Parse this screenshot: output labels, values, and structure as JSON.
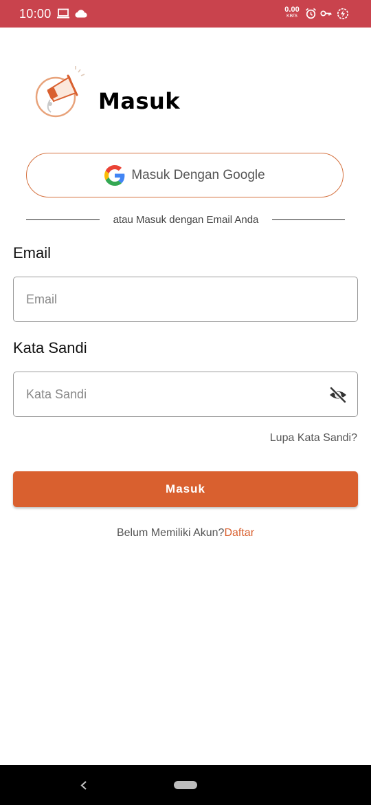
{
  "status_bar": {
    "time": "10:00",
    "net_speed": "0.00",
    "net_unit": "KB/S",
    "background": "#c9434d",
    "icons": [
      "laptop-icon",
      "cloud-icon",
      "alarm-icon",
      "key-icon",
      "battery-charging-icon"
    ]
  },
  "header": {
    "title": "Masuk",
    "logo_icon": "megaphone-logo-icon"
  },
  "google_button": {
    "label": "Masuk Dengan Google",
    "icon": "google-icon"
  },
  "divider": {
    "text": "atau Masuk dengan Email Anda"
  },
  "email": {
    "label": "Email",
    "placeholder": "Email",
    "value": ""
  },
  "password": {
    "label": "Kata Sandi",
    "placeholder": "Kata Sandi",
    "value": "",
    "toggle_icon": "eye-off-icon"
  },
  "forgot_password": "Lupa Kata Sandi?",
  "login_button": "Masuk",
  "register": {
    "prompt": "Belum Memiliki Akun?",
    "link": "Daftar"
  },
  "colors": {
    "accent": "#d9602f",
    "status_bar": "#c9434d",
    "google_border": "#d4703e"
  },
  "nav_bar": {
    "icons": [
      "back-icon",
      "home-pill-icon"
    ]
  }
}
